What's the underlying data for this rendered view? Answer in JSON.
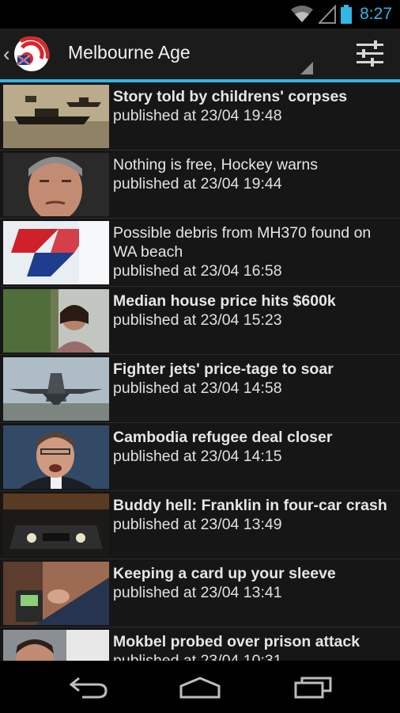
{
  "status_bar": {
    "time": "8:27"
  },
  "action_bar": {
    "title": "Melbourne Age"
  },
  "articles": [
    {
      "title": "Story told by childrens' corpses",
      "date": "published at 23/04 19:48",
      "bold": true
    },
    {
      "title": "Nothing is free, Hockey warns",
      "date": "published at 23/04 19:44",
      "bold": false
    },
    {
      "title": "Possible debris from MH370 found on WA beach",
      "date": "published at 23/04 16:58",
      "bold": false
    },
    {
      "title": "Median house price hits $600k",
      "date": "published at 23/04 15:23",
      "bold": true
    },
    {
      "title": "Fighter jets' price-tage to soar",
      "date": "published at 23/04 14:58",
      "bold": true
    },
    {
      "title": "Cambodia refugee deal closer",
      "date": "published at 23/04 14:15",
      "bold": true
    },
    {
      "title": "Buddy hell: Franklin in four-car crash",
      "date": "published at 23/04 13:49",
      "bold": true
    },
    {
      "title": "Keeping a card up your sleeve",
      "date": "published at 23/04 13:41",
      "bold": true
    },
    {
      "title": "Mokbel probed over prison attack",
      "date": "published at 23/04 10:31",
      "bold": true
    }
  ],
  "colors": {
    "accent": "#33b5e5",
    "app_icon_red": "#d9262b"
  }
}
